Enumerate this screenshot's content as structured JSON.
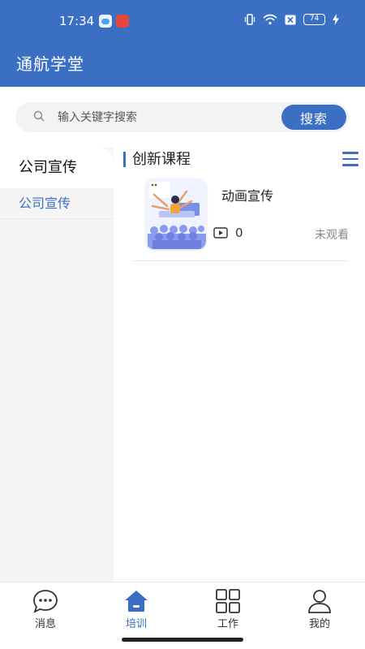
{
  "status_bar": {
    "time": "17:34",
    "battery": "74"
  },
  "header": {
    "title": "通航学堂"
  },
  "search": {
    "placeholder": "输入关键字搜索",
    "value": "",
    "button_label": "搜索"
  },
  "sidebar": {
    "heading": "公司宣传",
    "items": [
      {
        "label": "公司宣传"
      }
    ]
  },
  "section": {
    "title": "创新课程"
  },
  "courses": [
    {
      "title": "动画宣传",
      "views": "0",
      "status": "未观看"
    }
  ],
  "tabbar": {
    "items": [
      {
        "label": "消息",
        "icon": "message-icon"
      },
      {
        "label": "培训",
        "icon": "home-icon",
        "active": true
      },
      {
        "label": "工作",
        "icon": "grid-icon"
      },
      {
        "label": "我的",
        "icon": "user-icon"
      }
    ]
  },
  "colors": {
    "primary": "#3a6fc4",
    "sidebar_bg": "#f5f5f5"
  }
}
